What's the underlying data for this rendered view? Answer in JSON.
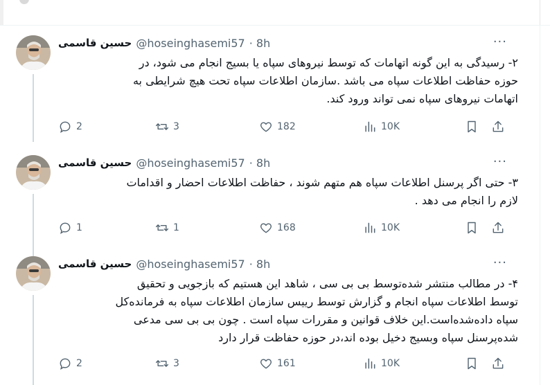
{
  "tweets": [
    {
      "name": "حسین قاسمی",
      "handle": "@hoseinghasemi57",
      "time": "· 8h",
      "lines": [
        "۲- رسیدگی به این گونه اتهامات  که توسط نیروهای سپاه یا بسیج انجام می شود، در",
        "حوزه حفاظت اطلاعات سپاه می باشد .سازمان اطلاعات سپاه تحت هیچ شرایطی به",
        "اتهامات نیروهای سپاه نمی تواند ورود کند."
      ],
      "replies": "2",
      "retweets": "3",
      "likes": "182",
      "views": "10K"
    },
    {
      "name": "حسین قاسمی",
      "handle": "@hoseinghasemi57",
      "time": "· 8h",
      "lines": [
        "۳- حتی اگر پرسنل اطلاعات سپاه هم متهم شوند ، حفاظت اطلاعات احضار و اقدامات",
        "لازم را انجام می دهد ."
      ],
      "replies": "1",
      "retweets": "1",
      "likes": "168",
      "views": "10K"
    },
    {
      "name": "حسین قاسمی",
      "handle": "@hoseinghasemi57",
      "time": "· 8h",
      "lines": [
        "۴- در مطالب منتشر شده‌توسط بی بی سی ، شاهد این هستیم که بازجویی و تحقیق",
        "توسط اطلاعات سپاه انجام و گزارش توسط رییس سازمان اطلاعات سپاه به فرمانده‌کل",
        "سپاه داده‌شده‌است.این خلاف قوانین و مقررات سپاه است . چون بی بی سی مدعی",
        "شده‌پرسنل سپاه وبسیج دخیل بوده اند،در حوزه حفاظت قرار دارد"
      ],
      "replies": "2",
      "retweets": "3",
      "likes": "161",
      "views": "10K"
    }
  ]
}
